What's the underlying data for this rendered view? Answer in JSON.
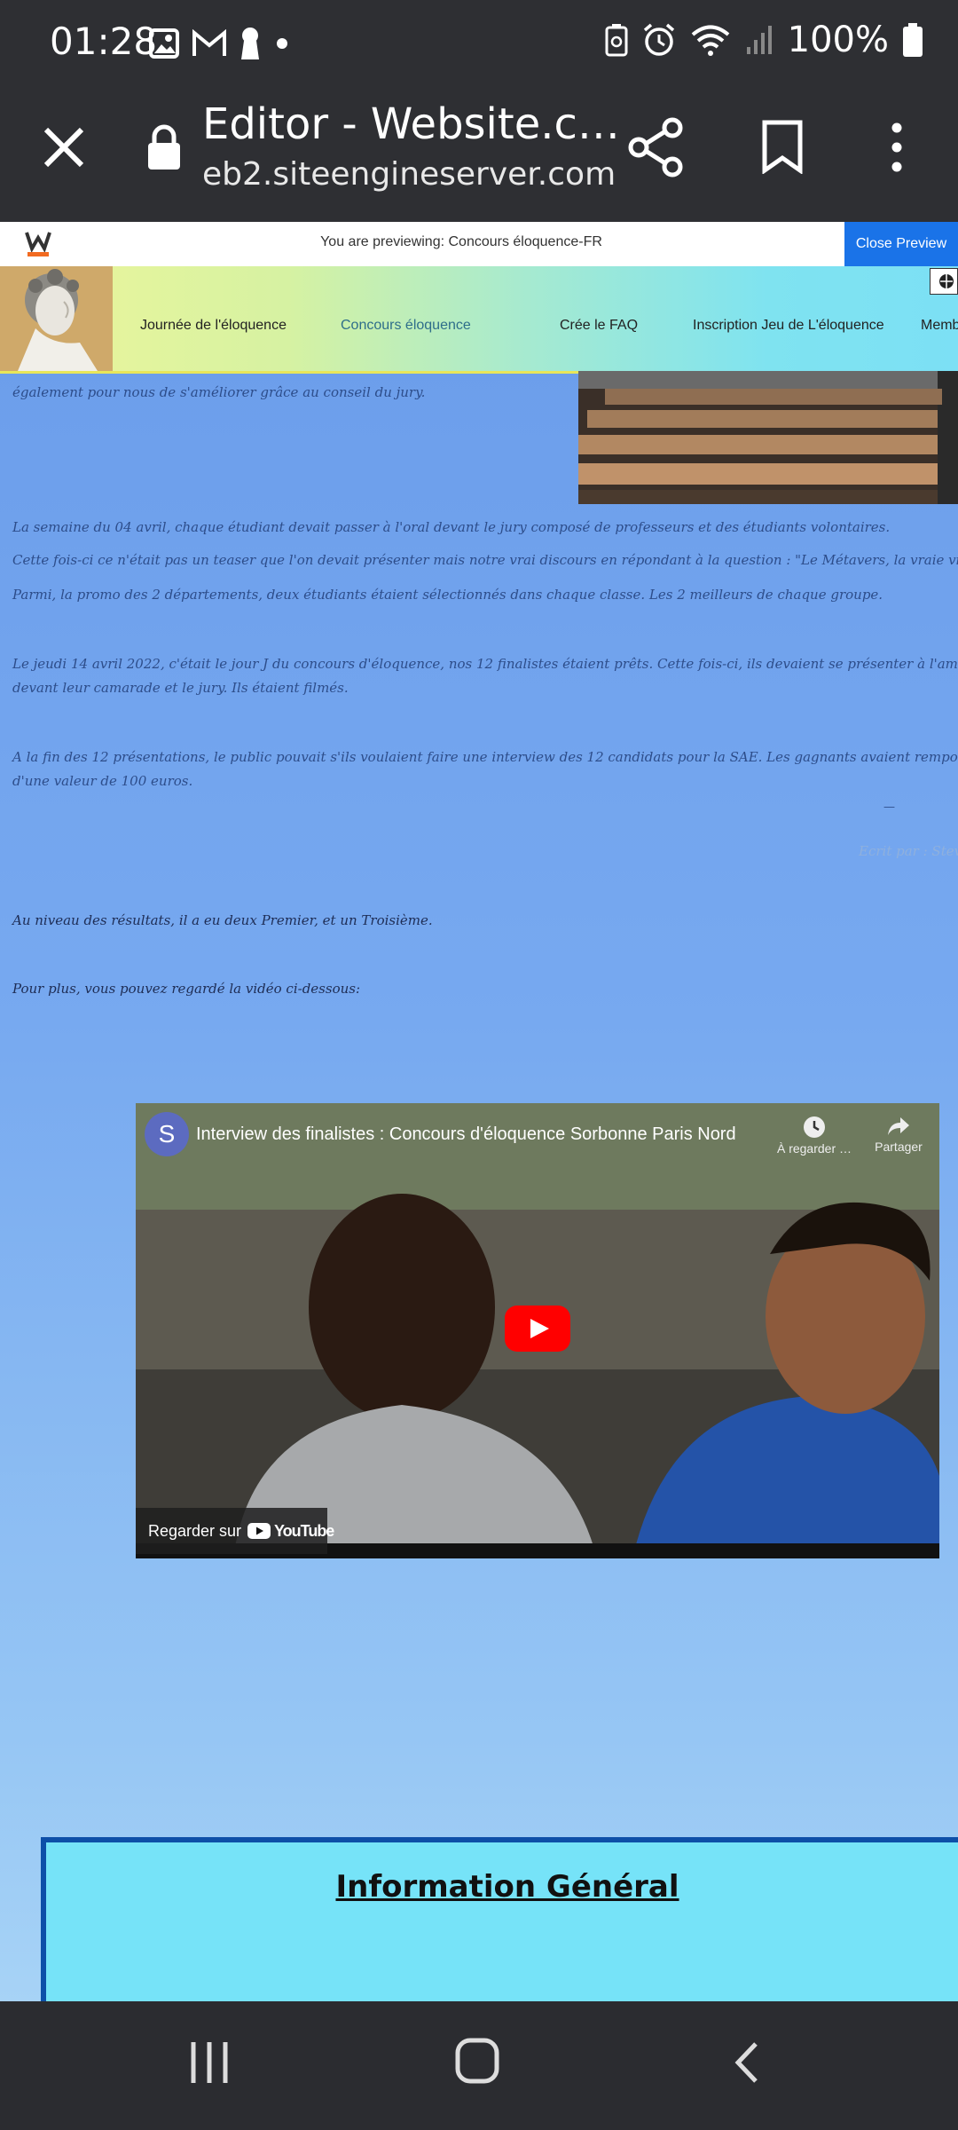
{
  "status_bar": {
    "time": "01:28",
    "battery": "100%"
  },
  "browser": {
    "title": "Editor - Website.c…",
    "url": "eb2.siteengineserver.com"
  },
  "preview_bar": {
    "text": "You are previewing: Concours éloquence-FR",
    "close_label": "Close Preview"
  },
  "site_nav": {
    "items": [
      {
        "label": "Journée de l'éloquence"
      },
      {
        "label": "Concours éloquence"
      },
      {
        "label": "Crée le FAQ"
      },
      {
        "label": "Inscription Jeu de L'éloquence"
      },
      {
        "label": "Memb"
      }
    ],
    "active_color": "#2e6e8a"
  },
  "content": {
    "para0": "également pour nous de s'améliorer grâce au conseil du jury.",
    "para1": "La semaine du 04 avril, chaque étudiant devait passer à l'oral devant le jury composé de professeurs et des étudiants volontaires.",
    "para2": "Cette fois-ci ce n'était pas un teaser que l'on devait présenter mais notre vrai discours en répondant à la question : \"Le Métavers, la vraie vie est ailleurs",
    "para3": "Parmi, la promo des 2 départements, deux étudiants étaient sélectionnés dans chaque classe. Les 2 meilleurs de chaque groupe.",
    "para4a": "Le jeudi 14 avril 2022, c'était le jour J du concours d'éloquence, nos 12 finalistes étaient prêts. Cette fois-ci, ils devaient se présenter à l'amphithé",
    "para4b": "devant leur camarade et le jury. Ils étaient filmés.",
    "para5a": "A la fin des 12 présentations, le public pouvait s'ils voulaient faire une interview des 12 candidats pour la SAE. Les gagnants avaient remporté un bo",
    "para5b": "d'une valeur de 100 euros.",
    "dash": "—",
    "author": "Ecrit par : Stev",
    "results": "Au niveau des résultats, il a eu deux Premier, et un Troisième.",
    "more": "Pour plus, vous pouvez regardé la vidéo ci-dessous:"
  },
  "video": {
    "channel_initial": "S",
    "title": "Interview des finalistes : Concours d'éloquence Sorbonne Paris Nord",
    "watch_later": "À regarder …",
    "share": "Partager",
    "watch_on": "Regarder sur",
    "youtube": "YouTube"
  },
  "info": {
    "title": "Information Général"
  },
  "colors": {
    "accent": "#1a73e8",
    "info_bg": "#76e3f8",
    "info_border": "#0d4fa8"
  }
}
